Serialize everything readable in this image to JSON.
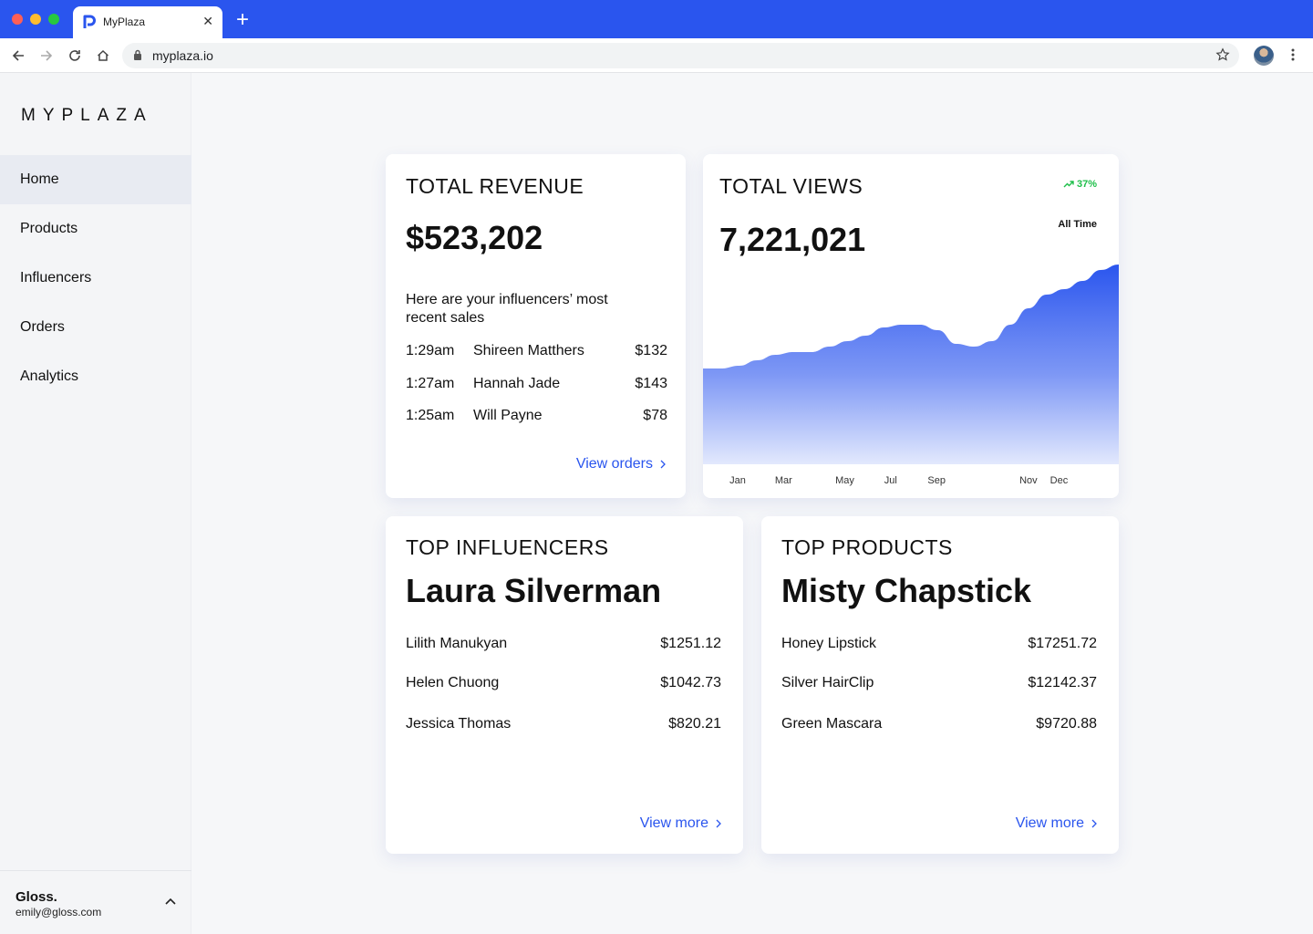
{
  "browser": {
    "tab_title": "MyPlaza",
    "url": "myplaza.io"
  },
  "sidebar": {
    "logo": "MYPLAZA",
    "items": [
      {
        "label": "Home",
        "active": true
      },
      {
        "label": "Products"
      },
      {
        "label": "Influencers"
      },
      {
        "label": "Orders"
      },
      {
        "label": "Analytics"
      }
    ],
    "account": {
      "name": "Gloss.",
      "email": "emily@gloss.com"
    }
  },
  "revenue": {
    "title": "TOTAL REVENUE",
    "value": "$523,202",
    "subtitle": "Here are your influencers’ most recent sales",
    "sales": [
      {
        "time": "1:29am",
        "name": "Shireen Matthers",
        "amount": "$132"
      },
      {
        "time": "1:27am",
        "name": "Hannah Jade",
        "amount": "$143"
      },
      {
        "time": "1:25am",
        "name": "Will Payne",
        "amount": "$78"
      }
    ],
    "link": "View orders"
  },
  "views": {
    "title": "TOTAL VIEWS",
    "value": "7,221,021",
    "badge": "37%",
    "period": "All Time",
    "accent": "#2a55ee",
    "badge_color": "#1fbf4a"
  },
  "influencers": {
    "title": "TOP INFLUENCERS",
    "leader": "Laura Silverman",
    "rows": [
      {
        "name": "Lilith Manukyan",
        "amount": "$1251.12"
      },
      {
        "name": "Helen Chuong",
        "amount": "$1042.73"
      },
      {
        "name": "Jessica Thomas",
        "amount": "$820.21"
      }
    ],
    "link": "View more"
  },
  "products": {
    "title": "TOP PRODUCTS",
    "leader": "Misty Chapstick",
    "rows": [
      {
        "name": "Honey Lipstick",
        "amount": "$17251.72"
      },
      {
        "name": "Silver HairClip",
        "amount": "$12142.37"
      },
      {
        "name": "Green Mascara",
        "amount": "$9720.88"
      }
    ],
    "link": "View more"
  },
  "chart_data": {
    "type": "area",
    "categories": [
      "Jan",
      "Mar",
      "May",
      "Jul",
      "Sep",
      "Nov",
      "Dec"
    ],
    "x": [
      "Jan",
      "",
      "",
      "Mar",
      "",
      "",
      "",
      "May",
      "",
      "",
      "Jul",
      "",
      "",
      "Sep",
      "",
      "",
      "",
      "",
      "",
      "Nov",
      "",
      "Dec",
      "",
      ""
    ],
    "values": [
      35,
      35,
      36,
      38,
      40,
      41,
      41,
      43,
      45,
      47,
      50,
      51,
      51,
      49,
      44,
      43,
      45,
      51,
      57,
      62,
      64,
      67,
      71,
      73
    ],
    "ylim": [
      0,
      80
    ],
    "title": "",
    "xlabel": "",
    "ylabel": "",
    "grid": false,
    "icons": {
      "badge": "trending-up-icon"
    }
  }
}
